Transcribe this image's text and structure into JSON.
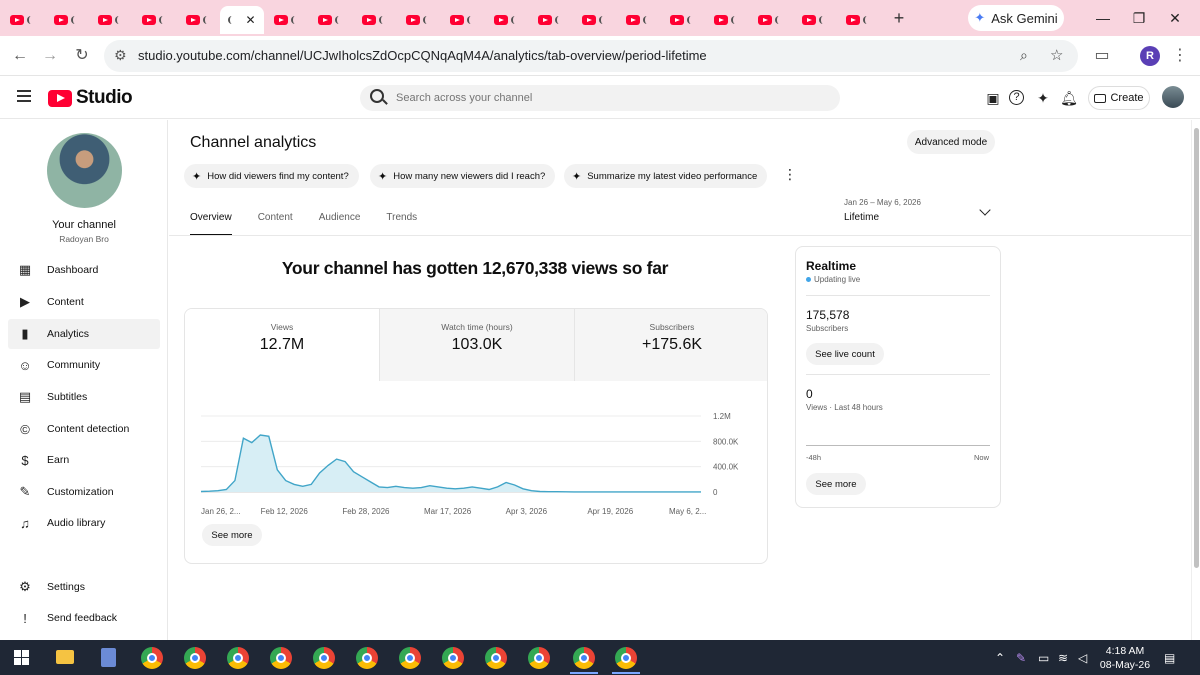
{
  "browser": {
    "tab_count": 20,
    "gemini_label": "Ask Gemini",
    "url": "studio.youtube.com/channel/UCJwIholcsZdOcpCQNqAqM4A/analytics/tab-overview/period-lifetime",
    "profile_initial": "R"
  },
  "header": {
    "logo_text": "Studio",
    "search_placeholder": "Search across your channel",
    "create_label": "Create"
  },
  "sidebar": {
    "channel_label": "Your channel",
    "channel_name": "Radoyan Bro",
    "items": [
      {
        "label": "Dashboard",
        "icon": "dashboard-icon",
        "glyph": "▦"
      },
      {
        "label": "Content",
        "icon": "content-icon",
        "glyph": "▶"
      },
      {
        "label": "Analytics",
        "icon": "analytics-icon",
        "glyph": "▮"
      },
      {
        "label": "Community",
        "icon": "community-icon",
        "glyph": "☺"
      },
      {
        "label": "Subtitles",
        "icon": "subtitles-icon",
        "glyph": "▤"
      },
      {
        "label": "Content detection",
        "icon": "content-detection-icon",
        "glyph": "©"
      },
      {
        "label": "Earn",
        "icon": "earn-icon",
        "glyph": "$"
      },
      {
        "label": "Customization",
        "icon": "customization-icon",
        "glyph": "✎"
      },
      {
        "label": "Audio library",
        "icon": "audio-library-icon",
        "glyph": "♫"
      }
    ],
    "bottom_items": [
      {
        "label": "Settings",
        "icon": "settings-icon",
        "glyph": "⚙"
      },
      {
        "label": "Send feedback",
        "icon": "feedback-icon",
        "glyph": "!"
      }
    ]
  },
  "main": {
    "title": "Channel analytics",
    "advanced_mode": "Advanced mode",
    "chips": [
      "How did viewers find my content?",
      "How many new viewers did I reach?",
      "Summarize my latest video performance"
    ],
    "tabs": [
      "Overview",
      "Content",
      "Audience",
      "Trends"
    ],
    "active_tab": "Overview",
    "period_range": "Jan 26 – May 6, 2026",
    "period_label": "Lifetime",
    "headline": "Your channel has gotten 12,670,338 views so far",
    "metrics": [
      {
        "label": "Views",
        "value": "12.7M"
      },
      {
        "label": "Watch time (hours)",
        "value": "103.0K"
      },
      {
        "label": "Subscribers",
        "value": "+175.6K"
      }
    ],
    "see_more": "See more"
  },
  "chart_data": {
    "type": "area",
    "series": [
      {
        "values": [
          8000,
          12000,
          20000,
          40000,
          180000,
          850000,
          780000,
          900000,
          880000,
          350000,
          180000,
          120000,
          90000,
          120000,
          300000,
          420000,
          520000,
          480000,
          320000,
          240000,
          160000,
          80000,
          70000,
          90000,
          70000,
          60000,
          70000,
          100000,
          80000,
          60000,
          50000,
          60000,
          80000,
          60000,
          40000,
          80000,
          150000,
          110000,
          50000,
          20000,
          8000,
          5000,
          4000,
          3000,
          2000,
          2000,
          1500,
          1500,
          1000,
          1000,
          1000,
          1000,
          1000,
          1000,
          1000,
          1000,
          1000,
          1000,
          1000,
          1000
        ]
      }
    ],
    "x_tick_labels": [
      "Jan 26, 2...",
      "Feb 12, 2026",
      "Feb 28, 2026",
      "Mar 17, 2026",
      "Apr 3, 2026",
      "Apr 19, 2026",
      "May 6, 2..."
    ],
    "y_tick_labels": [
      "1.2M",
      "800.0K",
      "400.0K",
      "0"
    ],
    "y_ticks": [
      1200000,
      800000,
      400000,
      0
    ],
    "ylim": [
      0,
      1200000
    ],
    "color": "#41a5c8"
  },
  "realtime": {
    "title": "Realtime",
    "status": "Updating live",
    "subscribers": "175,578",
    "subscribers_label": "Subscribers",
    "see_live_count": "See live count",
    "views": "0",
    "views_label": "Views · Last 48 hours",
    "axis_start": "-48h",
    "axis_end": "Now",
    "see_more": "See more"
  },
  "taskbar": {
    "time": "4:18 AM",
    "date": "08-May-26"
  }
}
